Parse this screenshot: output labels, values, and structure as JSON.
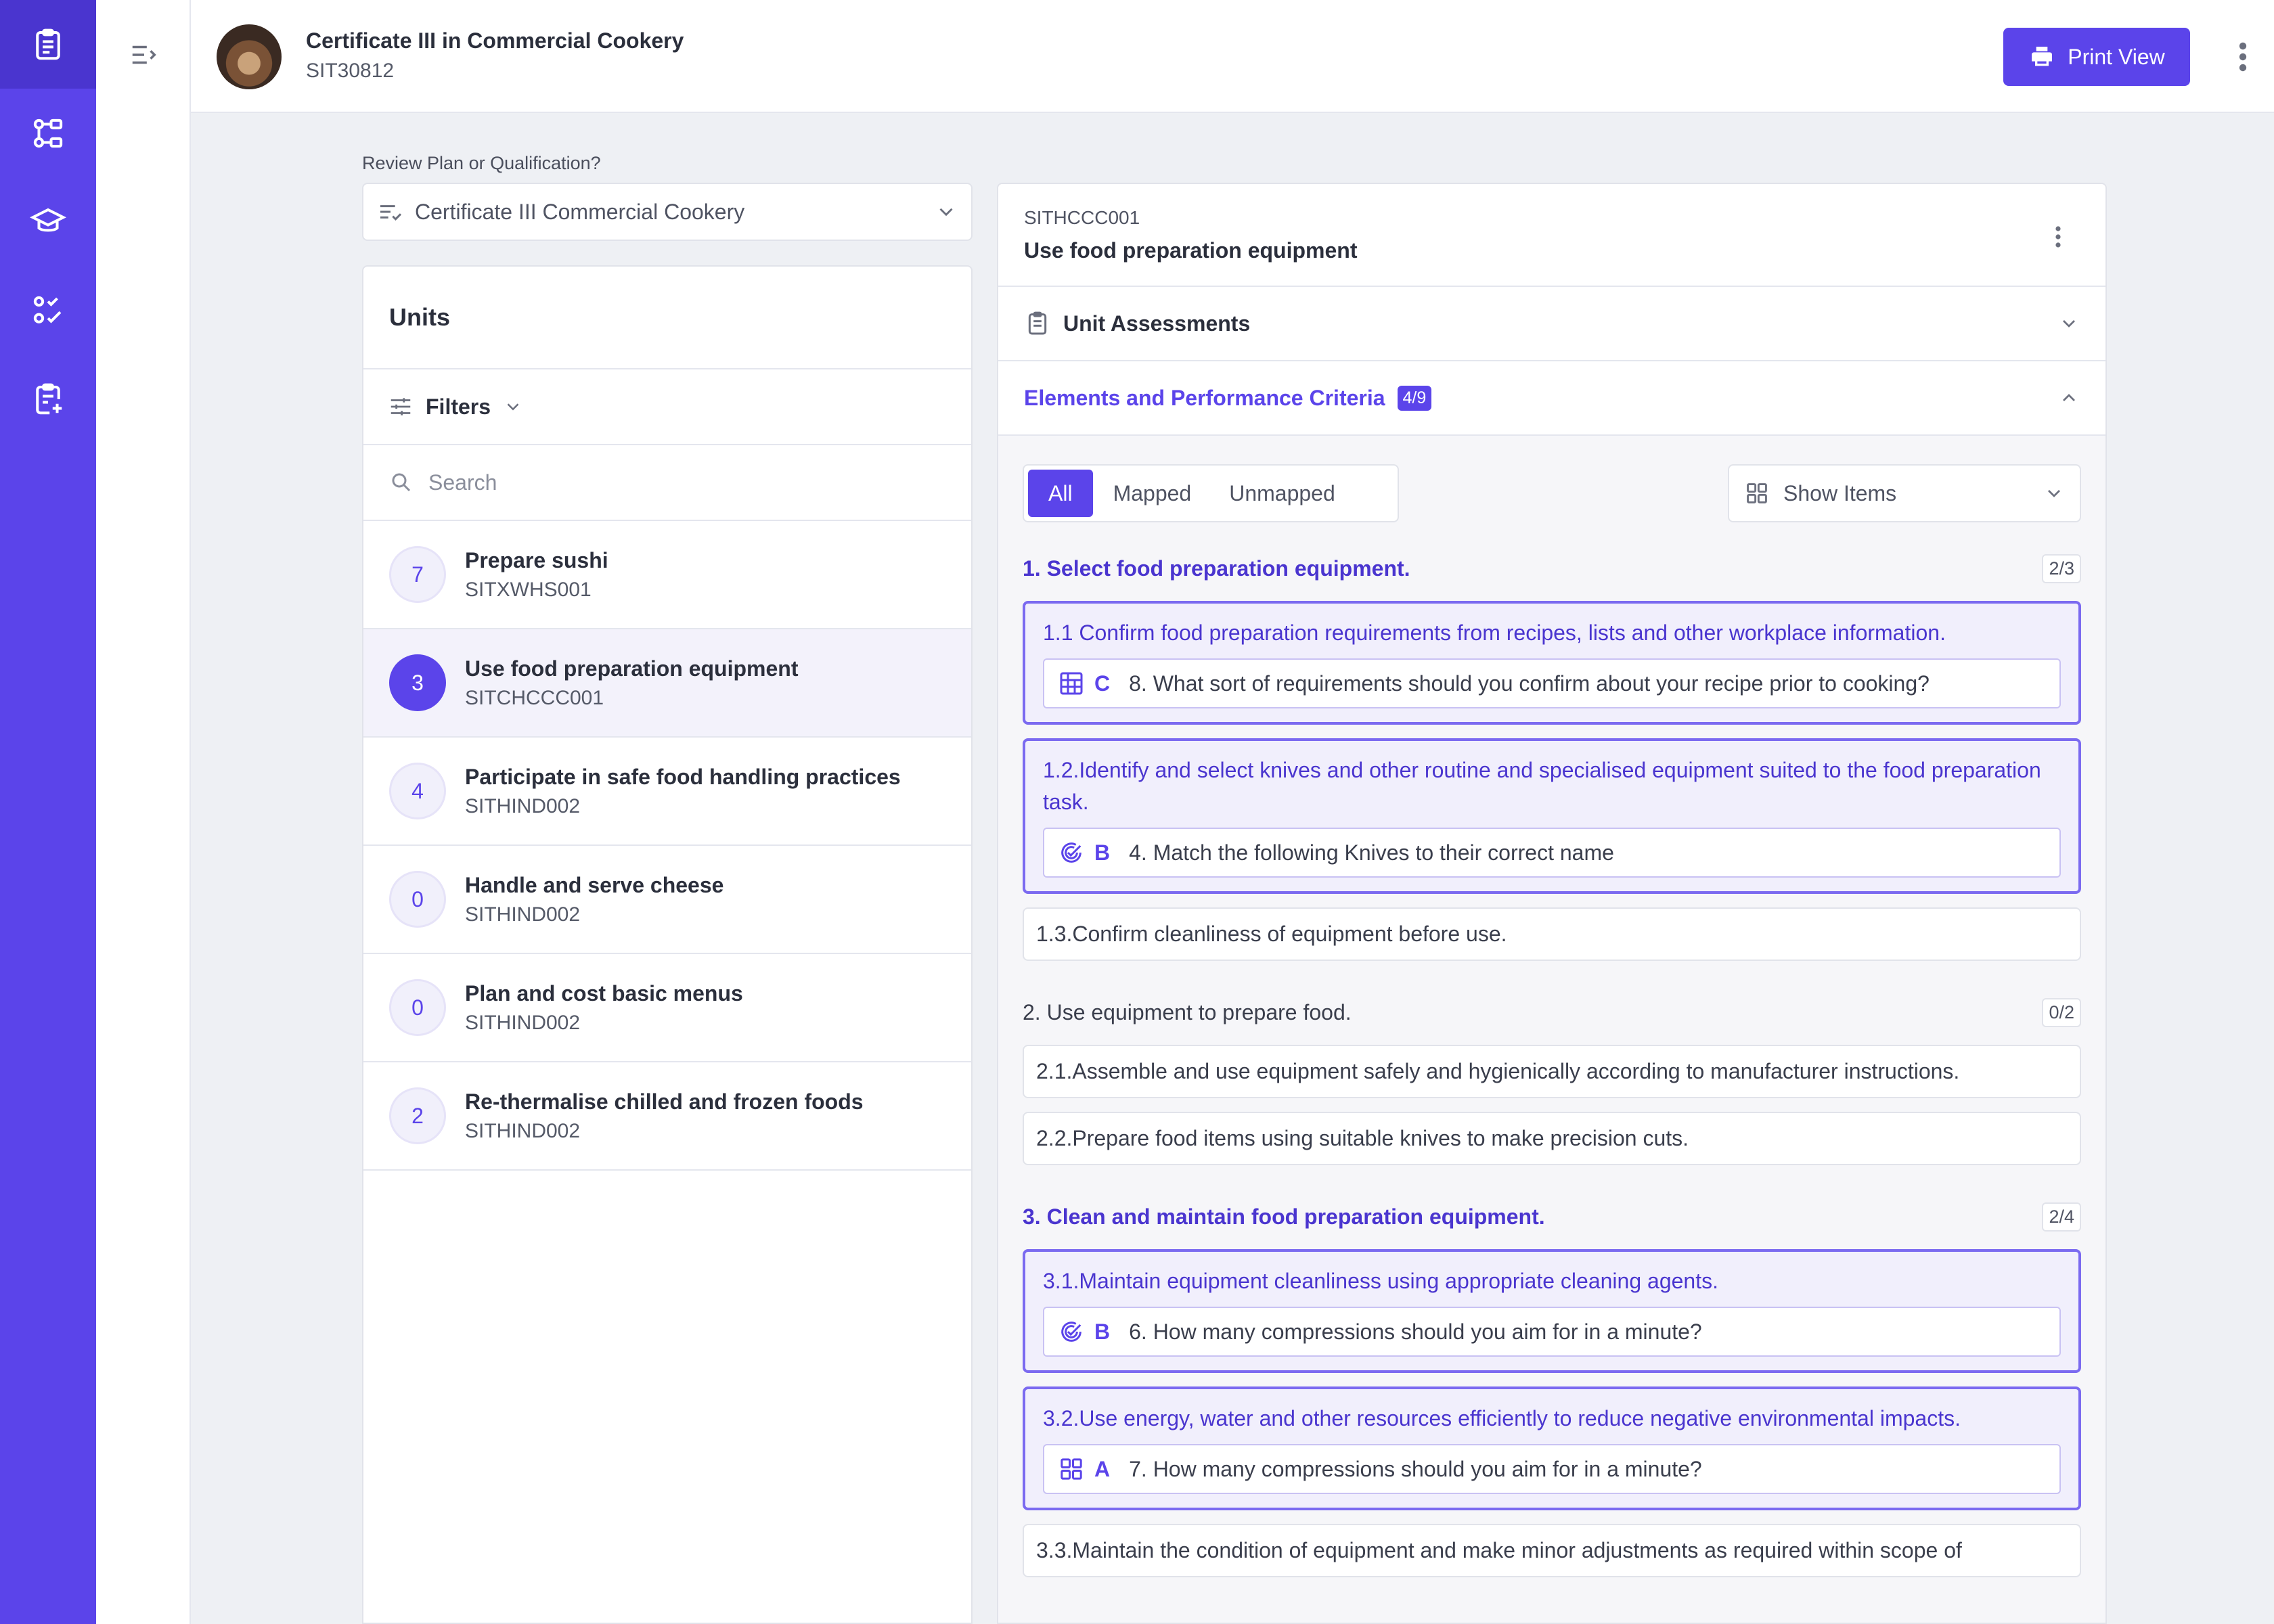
{
  "nav": {
    "rail": [
      {
        "icon": "clipboard-icon",
        "active": true
      },
      {
        "icon": "workflow-icon",
        "active": false
      },
      {
        "icon": "graduation-cap-icon",
        "active": false
      },
      {
        "icon": "checklist-icon",
        "active": false
      },
      {
        "icon": "clipboard-add-icon",
        "active": false
      }
    ]
  },
  "header": {
    "title": "Certificate III in Commercial Cookery",
    "code": "SIT30812",
    "print_label": "Print View"
  },
  "review": {
    "label": "Review Plan or Qualification?",
    "selected": "Certificate III Commercial Cookery"
  },
  "units": {
    "title": "Units",
    "filters_label": "Filters",
    "search_placeholder": "Search",
    "items": [
      {
        "count": "7",
        "name": "Prepare sushi",
        "code": "SITXWHS001",
        "selected": false
      },
      {
        "count": "3",
        "name": "Use food preparation equipment",
        "code": "SITCHCCC001",
        "selected": true
      },
      {
        "count": "4",
        "name": "Participate in safe food handling practices",
        "code": "SITHIND002",
        "selected": false
      },
      {
        "count": "0",
        "name": "Handle and serve cheese",
        "code": "SITHIND002",
        "selected": false
      },
      {
        "count": "0",
        "name": "Plan and cost basic menus",
        "code": "SITHIND002",
        "selected": false
      },
      {
        "count": "2",
        "name": "Re-thermalise chilled and frozen foods",
        "code": "SITHIND002",
        "selected": false
      }
    ]
  },
  "detail": {
    "code": "SITHCCC001",
    "title": "Use food preparation equipment",
    "assessments_label": "Unit Assessments",
    "epc_label": "Elements and Performance Criteria",
    "epc_count": "4/9",
    "filter_tabs": [
      "All",
      "Mapped",
      "Unmapped"
    ],
    "active_tab": "All",
    "show_items_label": "Show Items",
    "elements": [
      {
        "title": "1. Select food preparation equipment.",
        "ratio": "2/3",
        "mapped": true,
        "criteria": [
          {
            "text": "1.1 Confirm food preparation requirements from recipes, lists and other workplace information.",
            "mapped": true,
            "question": {
              "icon": "table-icon",
              "letter": "C",
              "text": "8. What sort of requirements should you confirm about your recipe prior to cooking?"
            }
          },
          {
            "text": "1.2.Identify and select knives and other routine and specialised equipment suited to the food preparation task.",
            "mapped": true,
            "question": {
              "icon": "check-badge-icon",
              "letter": "B",
              "text": "4. Match the following Knives to their correct name"
            }
          },
          {
            "text": "1.3.Confirm cleanliness of equipment before use.",
            "mapped": false
          }
        ]
      },
      {
        "title": "2. Use equipment to prepare food.",
        "ratio": "0/2",
        "mapped": false,
        "criteria": [
          {
            "text": "2.1.Assemble and use equipment safely and hygienically according to manufacturer instructions.",
            "mapped": false
          },
          {
            "text": "2.2.Prepare food items using suitable knives to make precision cuts.",
            "mapped": false
          }
        ]
      },
      {
        "title": "3. Clean and maintain food preparation equipment.",
        "ratio": "2/4",
        "mapped": true,
        "criteria": [
          {
            "text": "3.1.Maintain equipment cleanliness using appropriate cleaning agents.",
            "mapped": true,
            "question": {
              "icon": "check-badge-icon",
              "letter": "B",
              "text": "6. How many compressions should you aim for in a minute?"
            }
          },
          {
            "text": "3.2.Use energy, water and other resources efficiently to reduce negative environmental impacts.",
            "mapped": true,
            "question": {
              "icon": "grid-icon",
              "letter": "A",
              "text": "7. How many compressions should you aim for in a minute?"
            }
          },
          {
            "text": "3.3.Maintain the condition of equipment and make minor adjustments as required within scope of",
            "mapped": false
          }
        ]
      }
    ]
  },
  "colors": {
    "accent": "#5b44ea",
    "accent_dark": "#4a35cf",
    "mapped_bg": "#f1effc"
  }
}
